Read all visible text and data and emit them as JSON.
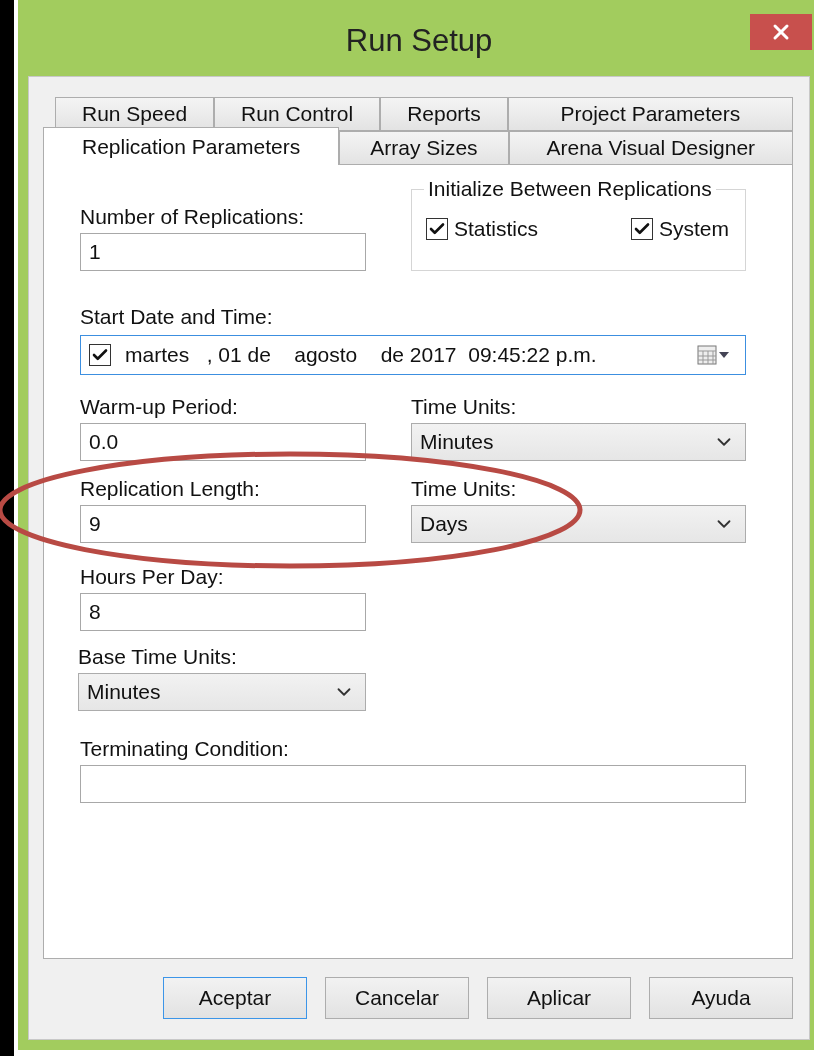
{
  "window": {
    "title": "Run Setup"
  },
  "tab_rows": [
    [
      {
        "label": "Run Speed",
        "selected": false
      },
      {
        "label": "Run Control",
        "selected": false
      },
      {
        "label": "Reports",
        "selected": false
      },
      {
        "label": "Project Parameters",
        "selected": false
      }
    ],
    [
      {
        "label": "Replication Parameters",
        "selected": true
      },
      {
        "label": "Array Sizes",
        "selected": false
      },
      {
        "label": "Arena Visual Designer",
        "selected": false
      }
    ]
  ],
  "number_of_replications": {
    "label": "Number of Replications:",
    "value": "1"
  },
  "initialize_group": {
    "title": "Initialize Between Replications",
    "checkboxes": [
      {
        "label": "Statistics",
        "checked": true
      },
      {
        "label": "System",
        "checked": true
      }
    ]
  },
  "start_date": {
    "label": "Start Date and Time:",
    "checked": true,
    "value": "martes   , 01 de    agosto    de 2017  09:45:22 p.m."
  },
  "warm_up_period": {
    "label": "Warm-up Period:",
    "value": "0.0"
  },
  "warm_up_units": {
    "label": "Time Units:",
    "value": "Minutes"
  },
  "replication_length": {
    "label": "Replication Length:",
    "value": "9"
  },
  "replication_units": {
    "label": "Time Units:",
    "value": "Days"
  },
  "hours_per_day": {
    "label": "Hours Per Day:",
    "value": "8"
  },
  "base_time_units": {
    "label": "Base Time Units:",
    "value": "Minutes"
  },
  "terminating_condition": {
    "label": "Terminating Condition:"
  },
  "annotation": {
    "kind": "ellipse",
    "color": "#b84a44"
  },
  "buttons": [
    {
      "label": "Aceptar",
      "focused": true
    },
    {
      "label": "Cancelar",
      "focused": false
    },
    {
      "label": "Aplicar",
      "focused": false
    },
    {
      "label": "Ayuda",
      "focused": false
    }
  ]
}
